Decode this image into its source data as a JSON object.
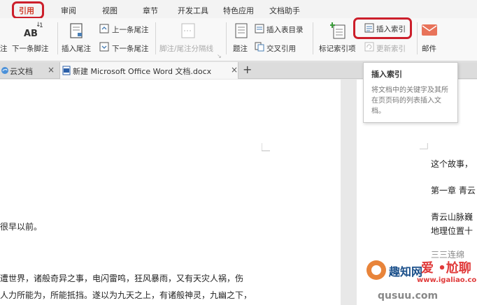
{
  "menu": {
    "tabs": [
      "引用",
      "审阅",
      "视图",
      "章节",
      "开发工具",
      "特色应用",
      "文档助手"
    ],
    "active_tab": "引用"
  },
  "ribbon": {
    "footnote_partial": "注",
    "next_footnote": "下一条脚注",
    "insert_endnote": "插入尾注",
    "prev_endnote": "上一条尾注",
    "next_endnote": "下一条尾注",
    "footnote_separator": "脚注/尾注分隔线",
    "caption": "题注",
    "insert_table_of_figures": "插入表目录",
    "cross_reference": "交叉引用",
    "mark_index_entry": "标记索引项",
    "insert_index": "插入索引",
    "update_index": "更新索引",
    "mail": "邮件",
    "ab_glyph": "AB",
    "ab_superscript": "1"
  },
  "tabs": {
    "cloud_docs": "云文档",
    "active_doc": "新建 Microsoft Office Word 文档.docx",
    "close_symbol": "×",
    "new_tab_symbol": "+"
  },
  "tooltip": {
    "title": "插入索引",
    "body": "将文档中的关键字及其所在页页码的列表插入文档。"
  },
  "document": {
    "left_page": {
      "line1": "很早以前。",
      "line2": "遭世界，诸般奇异之事，电闪雷鸣，狂风暴雨，又有天灾人祸，伤",
      "line3": "人力所能为，所能抵挡。遂以为九天之上，有诸般神灵，九幽之下，"
    },
    "right_page": {
      "line1": "这个故事，",
      "line2": "第一章 青云",
      "line3": "青云山脉巍",
      "line4": "地理位置十",
      "line5": "三三连绵"
    }
  },
  "watermark": {
    "left_text": "趣知网",
    "right_text": "爱 •尬聊",
    "url": "www.igaliao.com",
    "bottom": "qusuu.com"
  },
  "colors": {
    "highlight_red": "#cc1f2b",
    "active_tab_red": "#d33f2c",
    "mail_orange": "#e8735a",
    "icon_blue": "#4a7fb5"
  }
}
